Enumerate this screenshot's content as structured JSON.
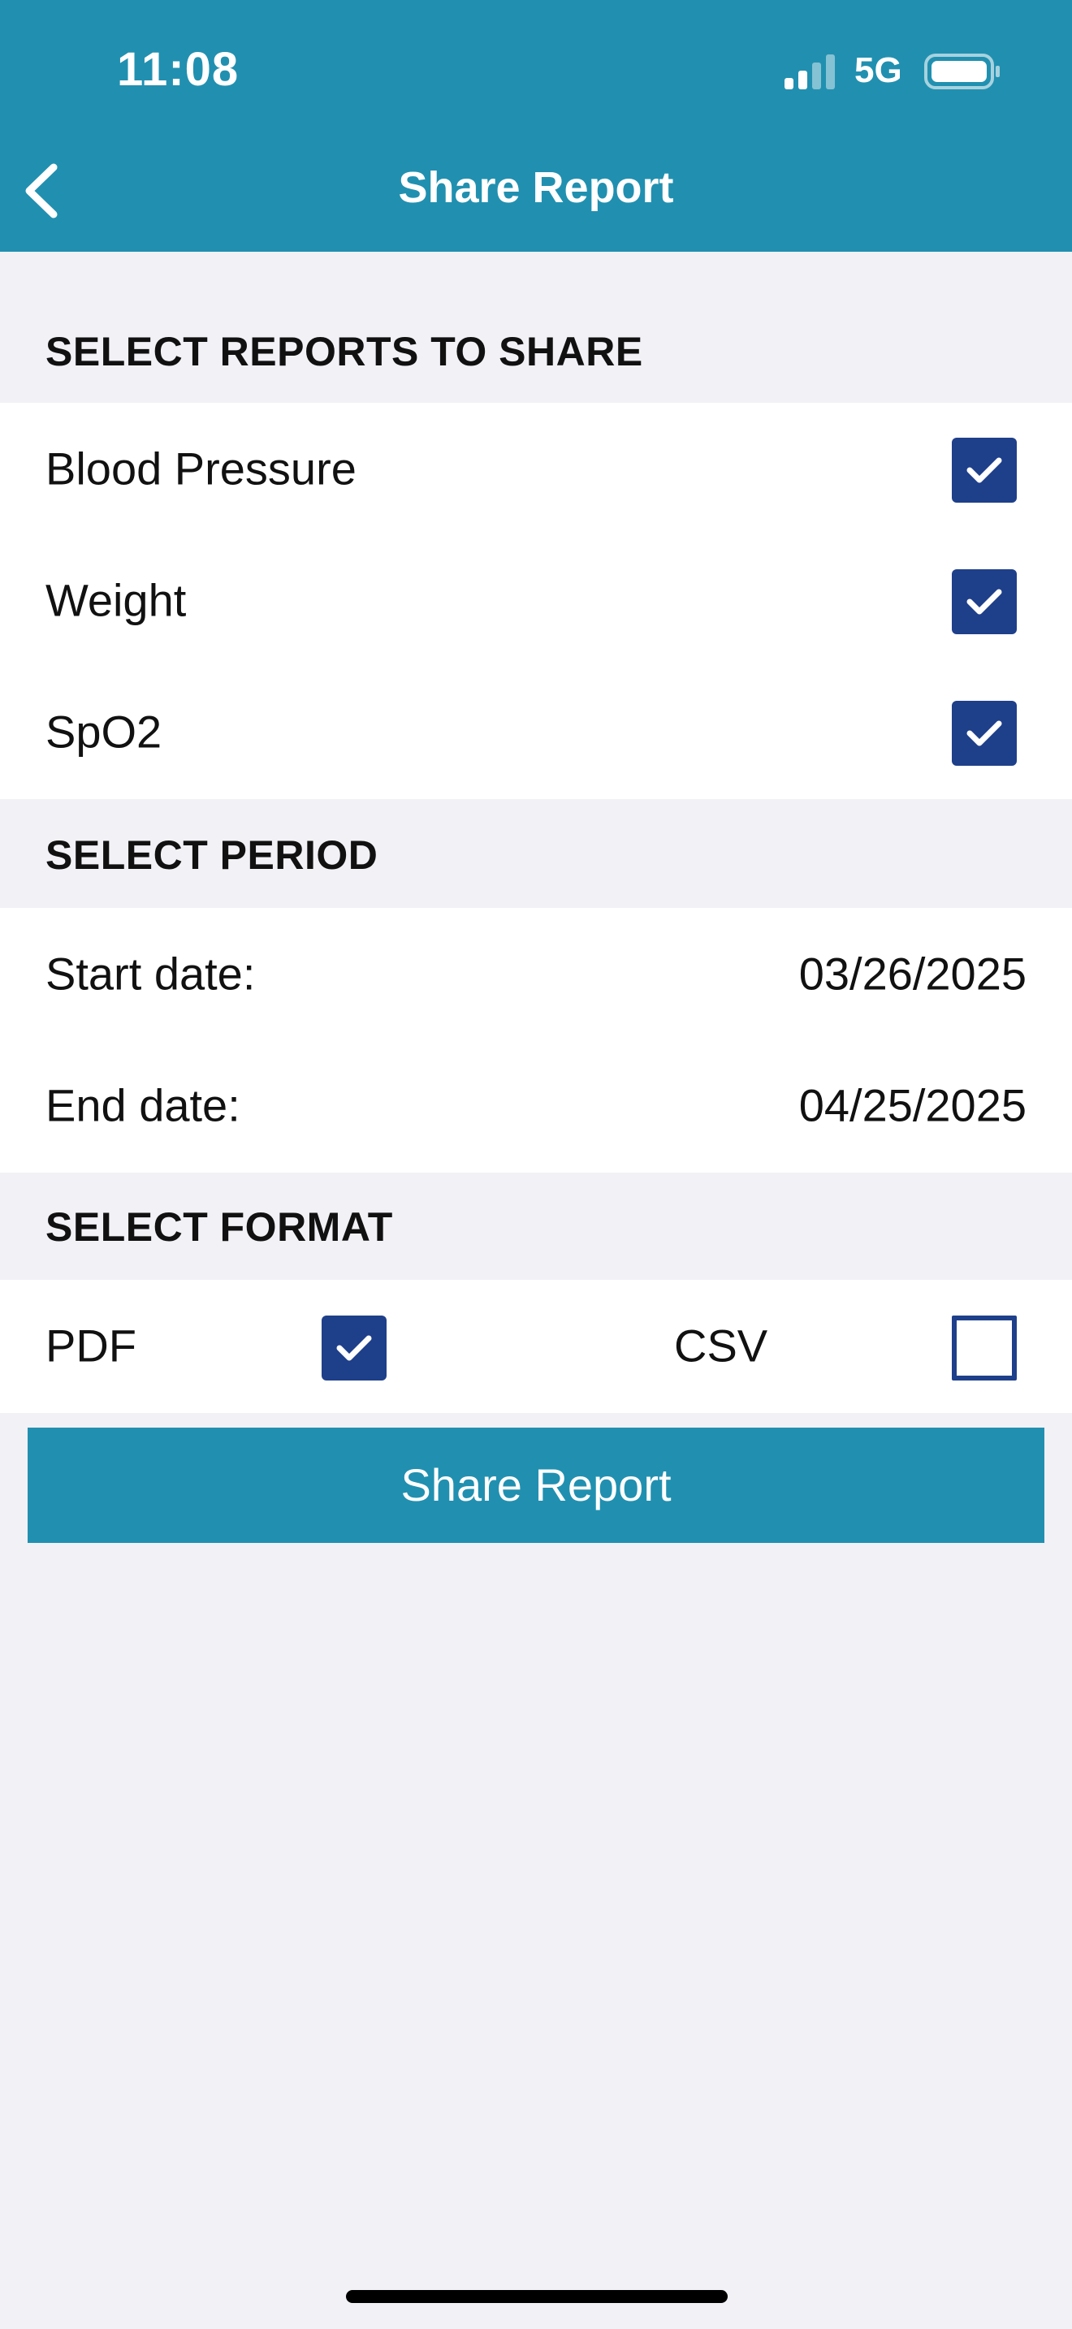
{
  "status_bar": {
    "time": "11:08",
    "network": "5G",
    "signal_bars_active": 2,
    "signal_bars_total": 4,
    "battery_level": 0.85,
    "icons": [
      "signal-icon",
      "battery-icon"
    ]
  },
  "nav": {
    "back_icon": "chevron-left-icon",
    "title": "Share Report"
  },
  "reports_section": {
    "title": "SELECT REPORTS TO SHARE",
    "items": [
      {
        "label": "Blood Pressure",
        "checked": true
      },
      {
        "label": "Weight",
        "checked": true
      },
      {
        "label": "SpO2",
        "checked": true
      }
    ]
  },
  "period_section": {
    "title": "SELECT PERIOD",
    "start_label": "Start date:",
    "start_value": "03/26/2025",
    "end_label": "End date:",
    "end_value": "04/25/2025"
  },
  "format_section": {
    "title": "SELECT FORMAT",
    "options": [
      {
        "label": "PDF",
        "checked": true
      },
      {
        "label": "CSV",
        "checked": false
      }
    ]
  },
  "share_button_label": "Share Report",
  "colors": {
    "header": "#2190b0",
    "checkbox": "#1e3f8a",
    "background": "#f1f1f6",
    "panel": "#ffffff"
  }
}
